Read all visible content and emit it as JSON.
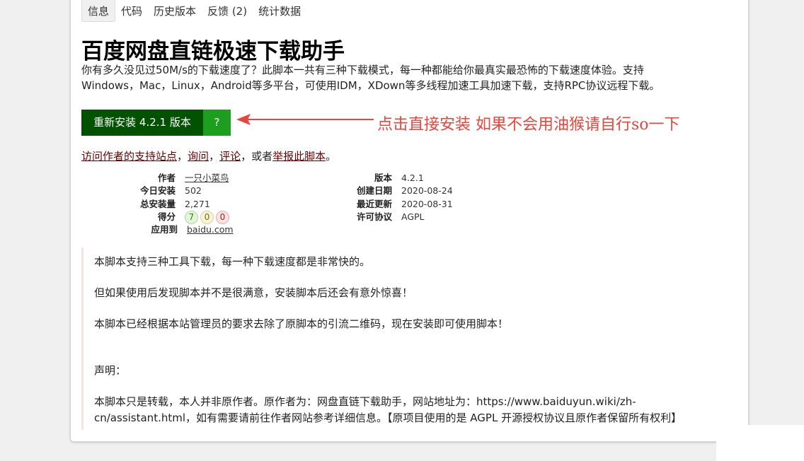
{
  "tabs": [
    "信息",
    "代码",
    "历史版本",
    "反馈 (2)",
    "统计数据"
  ],
  "title": "百度网盘直链极速下载助手",
  "description_line1": "你有多久没见过50M/s的下载速度了？此脚本一共有三种下载模式，每一种都能给你最真实最恐怖的下载速度体验。支持",
  "description_line2": "Windows，Mac，Linux，Android等多平台，可使用IDM，XDown等多线程加速工具加速下载，支持RPC协议远程下载。",
  "install": {
    "label": "重新安装 4.2.1 版本",
    "help": "?"
  },
  "annotation": "点击直接安装  如果不会用油猴请自行so一下",
  "links": {
    "site": "访问作者的支持站点",
    "sep1": "，",
    "ask": "询问",
    "sep2": "，",
    "review": "评论",
    "mid": "，或者",
    "report": "举报此脚本",
    "end": "。"
  },
  "meta_left": {
    "author_k": "作者",
    "author_v": "一只小菜鸟",
    "daily_k": "今日安装",
    "daily_v": "502",
    "total_k": "总安装量",
    "total_v": "2,271",
    "score_k": "得分",
    "score_good": "7",
    "score_ok": "0",
    "score_bad": "0",
    "applies_k": "应用到",
    "applies_v": "baidu.com"
  },
  "meta_right": {
    "version_k": "版本",
    "version_v": "4.2.1",
    "created_k": "创建日期",
    "created_v": "2020-08-24",
    "updated_k": "最近更新",
    "updated_v": "2020-08-31",
    "license_k": "许可协议",
    "license_v": "AGPL"
  },
  "content": {
    "p1": "本脚本支持三种工具下载，每一种下载速度都是非常快的。",
    "p2": "但如果使用后发现脚本并不是很满意，安装脚本后还会有意外惊喜！",
    "p3": "本脚本已经根据本站管理员的要求去除了原脚本的引流二维码，现在安装即可使用脚本！",
    "p4": "声明：",
    "p5a": "本脚本只是转载，本人并非原作者。原作者为：网盘直链下载助手，网站地址为：https://www.baiduyun.wiki/zh-",
    "p5b": "cn/assistant.html，如有需要请前往作者网站参考详细信息。【原项目使用的是 AGPL 开源授权协议且原作者保留所有权利】"
  },
  "colors": {
    "install": "#005200",
    "help": "#1e9e1e",
    "annotation": "#e8453c",
    "link": "#670000"
  }
}
